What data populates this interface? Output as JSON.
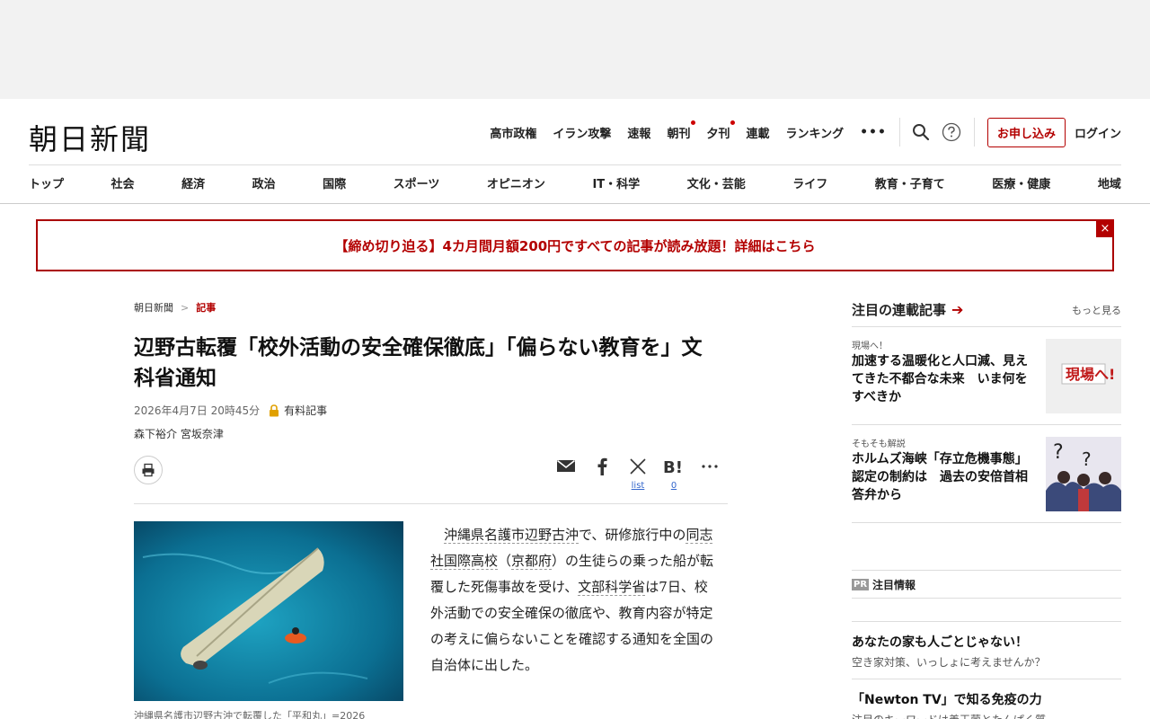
{
  "logo": "朝日新聞",
  "topnav": {
    "links": [
      {
        "label": "高市政権",
        "dot": false
      },
      {
        "label": "イラン攻撃",
        "dot": false
      },
      {
        "label": "速報",
        "dot": false
      },
      {
        "label": "朝刊",
        "dot": true
      },
      {
        "label": "夕刊",
        "dot": true
      },
      {
        "label": "連載",
        "dot": false
      },
      {
        "label": "ランキング",
        "dot": false
      }
    ],
    "more": "•••",
    "subscribe": "お申し込み",
    "login": "ログイン"
  },
  "categories": [
    "トップ",
    "社会",
    "経済",
    "政治",
    "国際",
    "スポーツ",
    "オピニオン",
    "IT・科学",
    "文化・芸能",
    "ライフ",
    "教育・子育て",
    "医療・健康",
    "地域"
  ],
  "banner": {
    "text": "【締め切り迫る】4カ月間月額200円ですべての記事が読み放題！詳細はこちら",
    "close": "×"
  },
  "article": {
    "breadcrumb": {
      "home": "朝日新聞",
      "sep": ">",
      "current": "記事"
    },
    "headline": "辺野古転覆「校外活動の安全確保徹底」「偏らない教育を」文科省通知",
    "date": "2026年4月7日 20時45分",
    "paid": "有料記事",
    "authors": "森下裕介 宮坂奈津",
    "share": {
      "x_count": "list",
      "hatena_count": "0"
    },
    "body": {
      "p1": "沖縄県名護市辺野古沖",
      "p2": "で、研修旅行中の",
      "p3": "同志社国際高校",
      "p4": "（",
      "p5": "京都府",
      "p6": "）の生徒らの乗った船が転覆した死傷事故を受け、",
      "p7": "文部科学省",
      "p8": "は7日、校外活動での安全確保の徹底や、教育内容が特定の考えに偏らないことを確認する通知を全国の自治体に出した。"
    },
    "caption": "沖縄県名護市辺野古沖で転覆した「平和丸」=2026"
  },
  "sidebar": {
    "title": "注目の連載記事",
    "more": "もっと見る",
    "items": [
      {
        "kicker": "現場へ！",
        "title": "加速する温暖化と人口減、見えてきた不都合な未来　いま何をすべきか",
        "thumb_text": "現場へ!"
      },
      {
        "kicker": "そもそも解説",
        "title": "ホルムズ海峡「存立危機事態」認定の制約は　過去の安倍首相答弁から",
        "thumb_text": "?"
      }
    ],
    "pr": {
      "badge": "PR",
      "title": "注目情報",
      "items": [
        {
          "title": "あなたの家も人ごとじゃない！",
          "sub": "空き家対策、いっしょに考えませんか？"
        },
        {
          "title": "「Newton TV」で知る免疫の力",
          "sub": "注目のキーワードは善玉菌とたんぱく質"
        }
      ]
    }
  }
}
